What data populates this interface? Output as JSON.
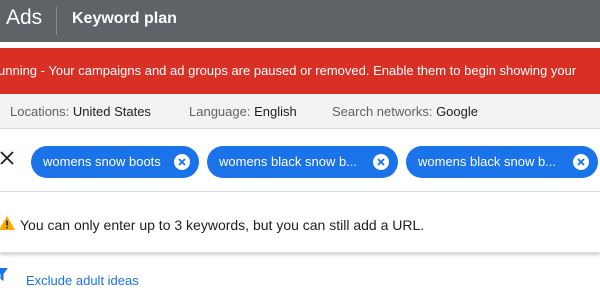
{
  "header": {
    "app_name": "Ads",
    "page_title": "Keyword plan",
    "background_color": "#5f6368"
  },
  "alert": {
    "text": "unning - Your campaigns and ad groups are paused or removed. Enable them to begin showing your",
    "color": "#d93025"
  },
  "filters": {
    "location_label": "Locations:",
    "location_value": "United States",
    "language_label": "Language:",
    "language_value": "English",
    "network_label": "Search networks:",
    "network_value": "Google"
  },
  "keywords": {
    "chips": [
      {
        "label": "womens snow boots"
      },
      {
        "label": "womens black snow b..."
      },
      {
        "label": "womens black snow b..."
      }
    ],
    "chip_color": "#1a73e8",
    "close_icon": "close-icon",
    "remove_icon": "cancel-circle-icon"
  },
  "warning": {
    "icon": "warning-triangle-icon",
    "text": "You can only enter up to 3 keywords, but you can still add a URL."
  },
  "exclude": {
    "icon": "filter-funnel-icon",
    "label": "Exclude adult ideas"
  }
}
